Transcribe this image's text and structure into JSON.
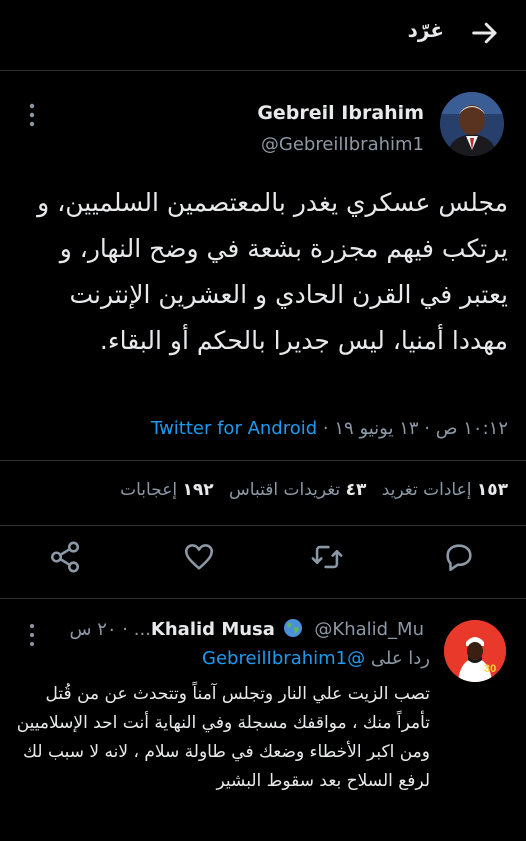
{
  "header": {
    "title": "غرّد",
    "back_icon": "arrow-right-icon"
  },
  "tweet": {
    "author_name": "Gebreil Ibrahim",
    "author_handle": "@GebreilIbrahim1",
    "text": "مجلس عسكري يغدر بالمعتصمين السلميين، و يرتكب فيهم مجزرة بشعة في وضح النهار، و يعتبر في القرن الحادي و العشرين الإنترنت مهددا أمنيا، ليس جديرا بالحكم أو البقاء.",
    "time": "١٠:١٢ ص",
    "date": "١٣ يونيو ١٩",
    "separator": "·",
    "source": "Twitter for Android"
  },
  "stats": {
    "retweets_count": "١٥٣",
    "retweets_label": "إعادات تغريد",
    "quotes_count": "٤٣",
    "quotes_label": "تغريدات اقتباس",
    "likes_count": "١٩٢",
    "likes_label": "إعجابات"
  },
  "actions": [
    "reply-icon",
    "retweet-icon",
    "like-icon",
    "share-icon"
  ],
  "reply": {
    "author_name": "Khalid Musa",
    "handle": "@Khalid_Mu...",
    "separator": "·",
    "time": "٢٠ س",
    "reply_to_label": "ردا على",
    "reply_to_handle": "@GebreilIbrahim1",
    "text": "تصب الزيت علي النار وتجلس آمناً وتتحدث عن من قُتل تأمراً منك ، مواقفك مسجلة وفي النهاية أنت احد الإسلاميين ومن اكبر الأخطاء وضعك في طاولة سلام ، لانه لا سبب لك لرفع السلاح بعد سقوط البشير",
    "avatar_badge": "30"
  },
  "colors": {
    "background": "#000000",
    "text": "#e7e9ea",
    "muted": "#8b98a5",
    "accent": "#1d9bf0",
    "divider": "#2f3336"
  }
}
